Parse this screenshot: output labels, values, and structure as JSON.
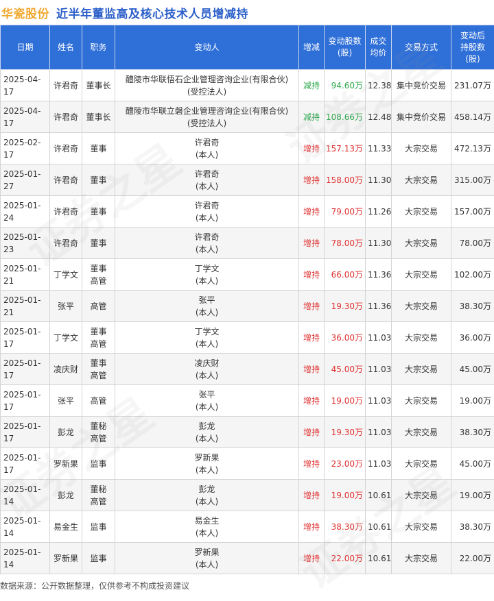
{
  "header": {
    "brand": "华瓷股份",
    "title": "近半年董监高及核心技术人员增减持"
  },
  "colors": {
    "brand": "#f0a830",
    "title": "#2b5fc9",
    "header_bg": "#2f6fd8",
    "increase": "#e03030",
    "decrease": "#2aa84a"
  },
  "table": {
    "columns": [
      [
        "日期"
      ],
      [
        "姓名"
      ],
      [
        "职务"
      ],
      [
        "变动人"
      ],
      [
        "增减"
      ],
      [
        "变动股数",
        "(股)"
      ],
      [
        "成交",
        "均价"
      ],
      [
        "交易方式"
      ],
      [
        "变动后",
        "持股数",
        "(股)"
      ]
    ],
    "rows": [
      {
        "date": "2025-04-17",
        "name": "许君奇",
        "position": [
          "董事长"
        ],
        "changer": [
          "醴陵市华联悟石企业管理咨询企业(有限合伙)",
          "(受控法人)"
        ],
        "type": "减持",
        "dir": "down",
        "amount": "94.60万",
        "price": "12.38",
        "method": "集中竞价交易",
        "after": "231.07万"
      },
      {
        "date": "2025-04-17",
        "name": "许君奇",
        "position": [
          "董事长"
        ],
        "changer": [
          "醴陵市华联立磐企业管理咨询企业(有限合伙)",
          "(受控法人)"
        ],
        "type": "减持",
        "dir": "down",
        "amount": "108.66万",
        "price": "12.48",
        "method": "集中竞价交易",
        "after": "458.14万"
      },
      {
        "date": "2025-02-17",
        "name": "许君奇",
        "position": [
          "董事"
        ],
        "changer": [
          "许君奇",
          "(本人)"
        ],
        "type": "增持",
        "dir": "up",
        "amount": "157.13万",
        "price": "11.33",
        "method": "大宗交易",
        "after": "472.13万"
      },
      {
        "date": "2025-01-27",
        "name": "许君奇",
        "position": [
          "董事"
        ],
        "changer": [
          "许君奇",
          "(本人)"
        ],
        "type": "增持",
        "dir": "up",
        "amount": "158.00万",
        "price": "11.30",
        "method": "大宗交易",
        "after": "315.00万"
      },
      {
        "date": "2025-01-24",
        "name": "许君奇",
        "position": [
          "董事"
        ],
        "changer": [
          "许君奇",
          "(本人)"
        ],
        "type": "增持",
        "dir": "up",
        "amount": "79.00万",
        "price": "11.26",
        "method": "大宗交易",
        "after": "157.00万"
      },
      {
        "date": "2025-01-23",
        "name": "许君奇",
        "position": [
          "董事"
        ],
        "changer": [
          "许君奇",
          "(本人)"
        ],
        "type": "增持",
        "dir": "up",
        "amount": "78.00万",
        "price": "11.30",
        "method": "大宗交易",
        "after": "78.00万"
      },
      {
        "date": "2025-01-21",
        "name": "丁学文",
        "position": [
          "董事",
          "高管"
        ],
        "changer": [
          "丁学文",
          "(本人)"
        ],
        "type": "增持",
        "dir": "up",
        "amount": "66.00万",
        "price": "11.36",
        "method": "大宗交易",
        "after": "102.00万"
      },
      {
        "date": "2025-01-21",
        "name": "张平",
        "position": [
          "高管"
        ],
        "changer": [
          "张平",
          "(本人)"
        ],
        "type": "增持",
        "dir": "up",
        "amount": "19.30万",
        "price": "11.36",
        "method": "大宗交易",
        "after": "38.30万"
      },
      {
        "date": "2025-01-17",
        "name": "丁学文",
        "position": [
          "董事",
          "高管"
        ],
        "changer": [
          "丁学文",
          "(本人)"
        ],
        "type": "增持",
        "dir": "up",
        "amount": "36.00万",
        "price": "11.03",
        "method": "大宗交易",
        "after": "36.00万"
      },
      {
        "date": "2025-01-17",
        "name": "凌庆财",
        "position": [
          "董事",
          "高管"
        ],
        "changer": [
          "凌庆财",
          "(本人)"
        ],
        "type": "增持",
        "dir": "up",
        "amount": "45.00万",
        "price": "11.03",
        "method": "大宗交易",
        "after": "45.00万"
      },
      {
        "date": "2025-01-17",
        "name": "张平",
        "position": [
          "高管"
        ],
        "changer": [
          "张平",
          "(本人)"
        ],
        "type": "增持",
        "dir": "up",
        "amount": "19.00万",
        "price": "11.03",
        "method": "大宗交易",
        "after": "19.00万"
      },
      {
        "date": "2025-01-17",
        "name": "彭龙",
        "position": [
          "董秘",
          "高管"
        ],
        "changer": [
          "彭龙",
          "(本人)"
        ],
        "type": "增持",
        "dir": "up",
        "amount": "19.30万",
        "price": "11.03",
        "method": "大宗交易",
        "after": "38.30万"
      },
      {
        "date": "2025-01-17",
        "name": "罗新果",
        "position": [
          "监事"
        ],
        "changer": [
          "罗新果",
          "(本人)"
        ],
        "type": "增持",
        "dir": "up",
        "amount": "23.00万",
        "price": "11.03",
        "method": "大宗交易",
        "after": "45.00万"
      },
      {
        "date": "2025-01-14",
        "name": "彭龙",
        "position": [
          "董秘",
          "高管"
        ],
        "changer": [
          "彭龙",
          "(本人)"
        ],
        "type": "增持",
        "dir": "up",
        "amount": "19.00万",
        "price": "10.61",
        "method": "大宗交易",
        "after": "19.00万"
      },
      {
        "date": "2025-01-14",
        "name": "易金生",
        "position": [
          "监事"
        ],
        "changer": [
          "易金生",
          "(本人)"
        ],
        "type": "增持",
        "dir": "up",
        "amount": "38.30万",
        "price": "10.61",
        "method": "大宗交易",
        "after": "38.30万"
      },
      {
        "date": "2025-01-14",
        "name": "罗新果",
        "position": [
          "监事"
        ],
        "changer": [
          "罗新果",
          "(本人)"
        ],
        "type": "增持",
        "dir": "up",
        "amount": "22.00万",
        "price": "10.61",
        "method": "大宗交易",
        "after": "22.00万"
      }
    ]
  },
  "footer": {
    "note": "数据来源：公开数据整理，仅供参考不构成投资建议"
  },
  "watermark": {
    "text": "证券之星"
  }
}
